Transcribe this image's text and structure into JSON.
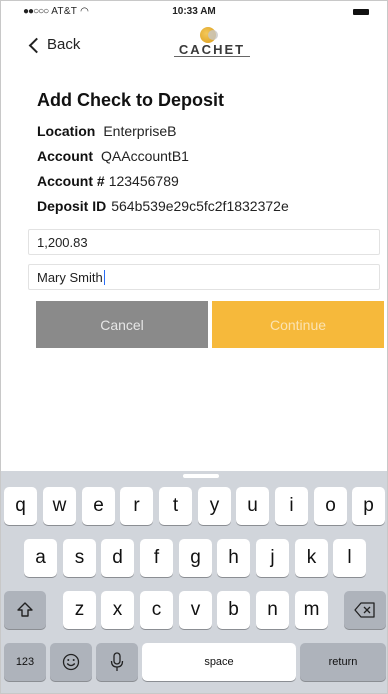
{
  "status_bar": {
    "carrier": "AT&T",
    "time": "10:33 AM"
  },
  "nav": {
    "back_label": "Back",
    "logo_text": "CACHET"
  },
  "form": {
    "title": "Add Check to Deposit",
    "location_label": "Location",
    "location_value": "EnterpriseB",
    "account_label": "Account",
    "account_value": "QAAccountB1",
    "account_number_label": "Account #",
    "account_number_value": "123456789",
    "deposit_id_label": "Deposit ID",
    "deposit_id_value": "564b539e29c5fc2f1832372e",
    "amount_value": "1,200.83",
    "payer_value": "Mary Smith",
    "cancel_label": "Cancel",
    "continue_label": "Continue"
  },
  "keyboard": {
    "row1": [
      "q",
      "w",
      "e",
      "r",
      "t",
      "y",
      "u",
      "i",
      "o",
      "p"
    ],
    "row2": [
      "a",
      "s",
      "d",
      "f",
      "g",
      "h",
      "j",
      "k",
      "l"
    ],
    "row3": [
      "z",
      "x",
      "c",
      "v",
      "b",
      "n",
      "m"
    ],
    "numbers_label": "123",
    "space_label": "space",
    "return_label": "return"
  },
  "colors": {
    "cancel_button": "#8a8a8a",
    "continue_button": "#f6b93b",
    "keyboard_bg": "#d1d5db"
  }
}
